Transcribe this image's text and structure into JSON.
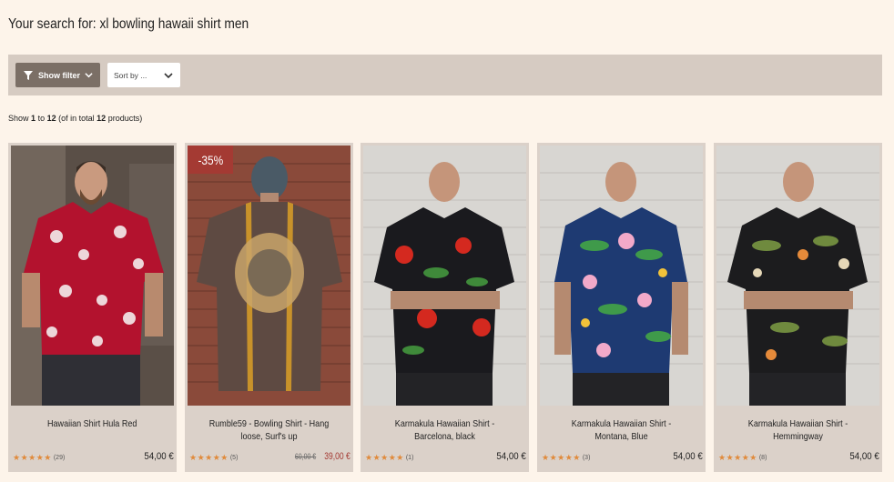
{
  "search": {
    "prefix": "Your search for:",
    "query": "xl bowling hawaii shirt men"
  },
  "toolbar": {
    "filter_label": "Show filter",
    "sort_label": "Sort by ..."
  },
  "results": {
    "show": "Show",
    "from": "1",
    "to_word": "to",
    "to": "12",
    "total_prefix": "(of in total",
    "total": "12",
    "total_suffix": "products)"
  },
  "products": [
    {
      "title": "Hawaiian Shirt Hula Red",
      "reviews": "(29)",
      "price": "54,00 €",
      "stars": "★★★★★",
      "image_icon": "red-hawaiian-shirt-photo"
    },
    {
      "title": "Rumble59 - Bowling Shirt - Hang loose, Surf's up",
      "reviews": "(5)",
      "old_price": "60,00 €",
      "price": "39,00 €",
      "badge": "-35%",
      "stars": "★★★★★",
      "image_icon": "bowling-shirt-back-photo"
    },
    {
      "title": "Karmakula Hawaiian Shirt - Barcelona, black",
      "reviews": "(1)",
      "price": "54,00 €",
      "stars": "★★★★★",
      "image_icon": "black-floral-shirt-photo"
    },
    {
      "title": "Karmakula Hawaiian Shirt - Montana, Blue",
      "reviews": "(3)",
      "price": "54,00 €",
      "stars": "★★★★★",
      "image_icon": "blue-floral-shirt-photo"
    },
    {
      "title": "Karmakula Hawaiian Shirt - Hemmingway",
      "reviews": "(8)",
      "price": "54,00 €",
      "stars": "★★★★★",
      "image_icon": "black-leaf-shirt-photo"
    }
  ],
  "colors": {
    "page_bg": "#fdf4ea",
    "toolbar_bg": "#d6cbc2",
    "filter_button": "#7b6f66",
    "sale": "#a43a33",
    "stars": "#e08a3b"
  }
}
